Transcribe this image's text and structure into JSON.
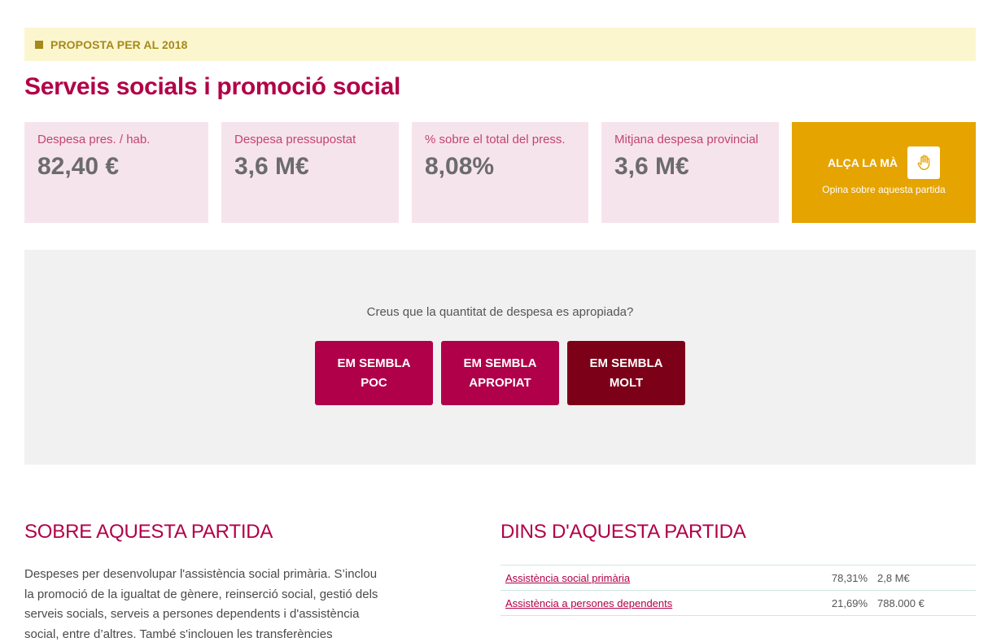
{
  "banner": {
    "label": "PROPOSTA PER AL 2018"
  },
  "title": "Serveis socials i promoció social",
  "kpis": [
    {
      "label": "Despesa pres. / hab.",
      "value": "82,40 €"
    },
    {
      "label": "Despesa pressupostat",
      "value": "3,6 M€"
    },
    {
      "label": "% sobre el total del press.",
      "value": "8,08%"
    },
    {
      "label": "Mitjana despesa provincial",
      "value": "3,6 M€"
    }
  ],
  "vote": {
    "label": "ALÇA LA MÀ",
    "sub": "Opina sobre aquesta partida",
    "icon": "hand-icon"
  },
  "survey": {
    "question": "Creus que la quantitat de despesa es apropiada?",
    "buttons": [
      "EM SEMBLA POC",
      "EM SEMBLA APROPIAT",
      "EM SEMBLA MOLT"
    ]
  },
  "about": {
    "heading": "SOBRE AQUESTA PARTIDA",
    "text": "Despeses per desenvolupar l'assistència social primària. S’inclou la promoció de la igualtat de gènere, reinserció social, gestió dels serveis socials, serveis a persones dependents i d'assistència social, entre d’altres. També s'inclouen les transferències"
  },
  "inside": {
    "heading": "DINS D'AQUESTA PARTIDA",
    "rows": [
      {
        "name": "Assistència social primària",
        "pct": "78,31%",
        "amount": "2,8 M€"
      },
      {
        "name": "Assistència a persones dependents",
        "pct": "21,69%",
        "amount": "788.000 €"
      }
    ]
  },
  "colors": {
    "accent": "#b10047",
    "dark_accent": "#7d0019",
    "gold": "#e5a400",
    "kpi_bg": "#f6e4ec",
    "banner_bg": "#fcf6cf"
  }
}
